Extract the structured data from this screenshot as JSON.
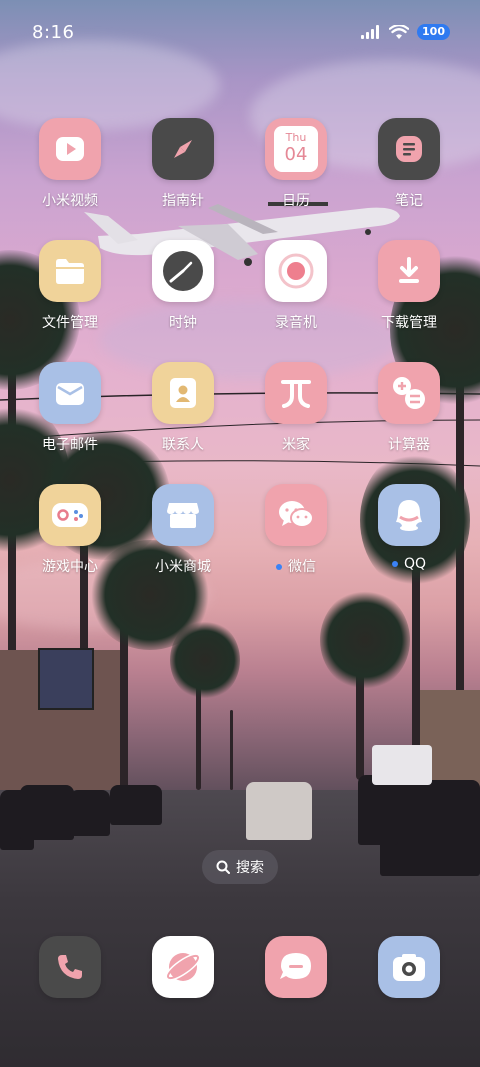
{
  "status": {
    "time": "8:16",
    "battery": "100",
    "icons": [
      "signal-icon",
      "wifi-icon",
      "battery-icon"
    ]
  },
  "apps": [
    {
      "name": "小米视频",
      "icon": "video-play-icon",
      "bg": "#f0a3ad"
    },
    {
      "name": "指南针",
      "icon": "compass-icon",
      "bg": "#4a4a4a"
    },
    {
      "name": "日历",
      "icon": "calendar-icon",
      "bg": "#f0a3ad",
      "day": "Thu",
      "date": "04"
    },
    {
      "name": "笔记",
      "icon": "notes-icon",
      "bg": "#4a4a4a"
    },
    {
      "name": "文件管理",
      "icon": "folder-icon",
      "bg": "#f0d39a"
    },
    {
      "name": "时钟",
      "icon": "clock-icon",
      "bg": "#ffffff"
    },
    {
      "name": "录音机",
      "icon": "recorder-icon",
      "bg": "#ffffff"
    },
    {
      "name": "下载管理",
      "icon": "download-icon",
      "bg": "#f0a3ad"
    },
    {
      "name": "电子邮件",
      "icon": "mail-icon",
      "bg": "#a9c0e6"
    },
    {
      "name": "联系人",
      "icon": "contacts-icon",
      "bg": "#f0d39a"
    },
    {
      "name": "米家",
      "icon": "mijia-icon",
      "bg": "#f0a3ad"
    },
    {
      "name": "计算器",
      "icon": "calculator-icon",
      "bg": "#f0a3ad"
    },
    {
      "name": "游戏中心",
      "icon": "gamepad-icon",
      "bg": "#f0d39a"
    },
    {
      "name": "小米商城",
      "icon": "store-icon",
      "bg": "#a9c0e6"
    },
    {
      "name": "微信",
      "icon": "wechat-icon",
      "bg": "#f0a3ad",
      "notify": true
    },
    {
      "name": "QQ",
      "icon": "qq-icon",
      "bg": "#a9c0e6",
      "notify": true
    }
  ],
  "search": {
    "label": "搜索"
  },
  "dock": [
    {
      "icon": "phone-icon",
      "bg": "#4a4a4a"
    },
    {
      "icon": "browser-icon",
      "bg": "#ffffff"
    },
    {
      "icon": "messages-icon",
      "bg": "#f0a3ad"
    },
    {
      "icon": "camera-icon",
      "bg": "#a9c0e6"
    }
  ]
}
